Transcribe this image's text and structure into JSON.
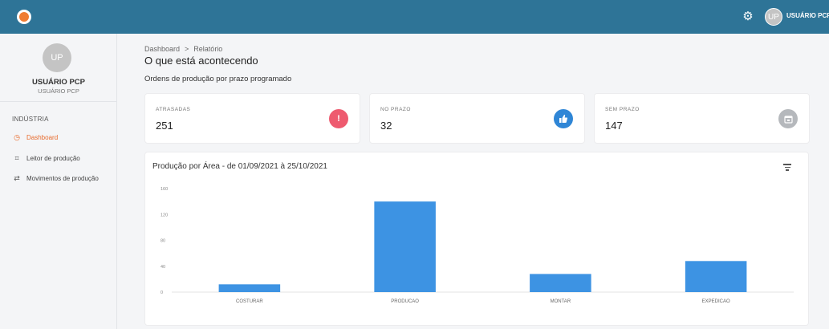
{
  "topbar": {
    "user_initials": "UP",
    "user_name": "USUÁRIO PCP"
  },
  "sidebar": {
    "avatar_initials": "UP",
    "user_name": "USUÁRIO PCP",
    "user_role": "USUÁRIO PCP",
    "section_title": "INDÚSTRIA",
    "items": [
      {
        "label": "Dashboard",
        "icon": "clock-icon",
        "active": true
      },
      {
        "label": "Leitor de produção",
        "icon": "scan-icon",
        "active": false
      },
      {
        "label": "Movimentos de produção",
        "icon": "transfer-icon",
        "active": false
      }
    ]
  },
  "breadcrumb": {
    "items": [
      "Dashboard",
      "Relatório"
    ],
    "separator": ">"
  },
  "page": {
    "title": "O que está acontecendo",
    "subtitle": "Ordens de produção por prazo programado"
  },
  "cards": [
    {
      "label": "ATRASADAS",
      "value": "251",
      "icon": "alert-icon",
      "color": "#ee5a6f"
    },
    {
      "label": "NO PRAZO",
      "value": "32",
      "icon": "thumbs-up-icon",
      "color": "#2f86d6"
    },
    {
      "label": "SEM PRAZO",
      "value": "147",
      "icon": "calendar-icon",
      "color": "#b5b8bc"
    }
  ],
  "chart_data": {
    "type": "bar",
    "title": "Produção por Área - de 01/09/2021 à 25/10/2021",
    "categories": [
      "COSTURAR",
      "PRODUCAO",
      "MONTAR",
      "EXPEDICAO"
    ],
    "values": [
      12,
      140,
      28,
      48
    ],
    "yticks": [
      0,
      40,
      80,
      120,
      160
    ],
    "ylim": [
      0,
      160
    ],
    "xlabel": "",
    "ylabel": "",
    "grid": false,
    "bar_color": "#3d93e3"
  },
  "colors": {
    "topbar": "#2e7497",
    "accent": "#e86a2b"
  }
}
